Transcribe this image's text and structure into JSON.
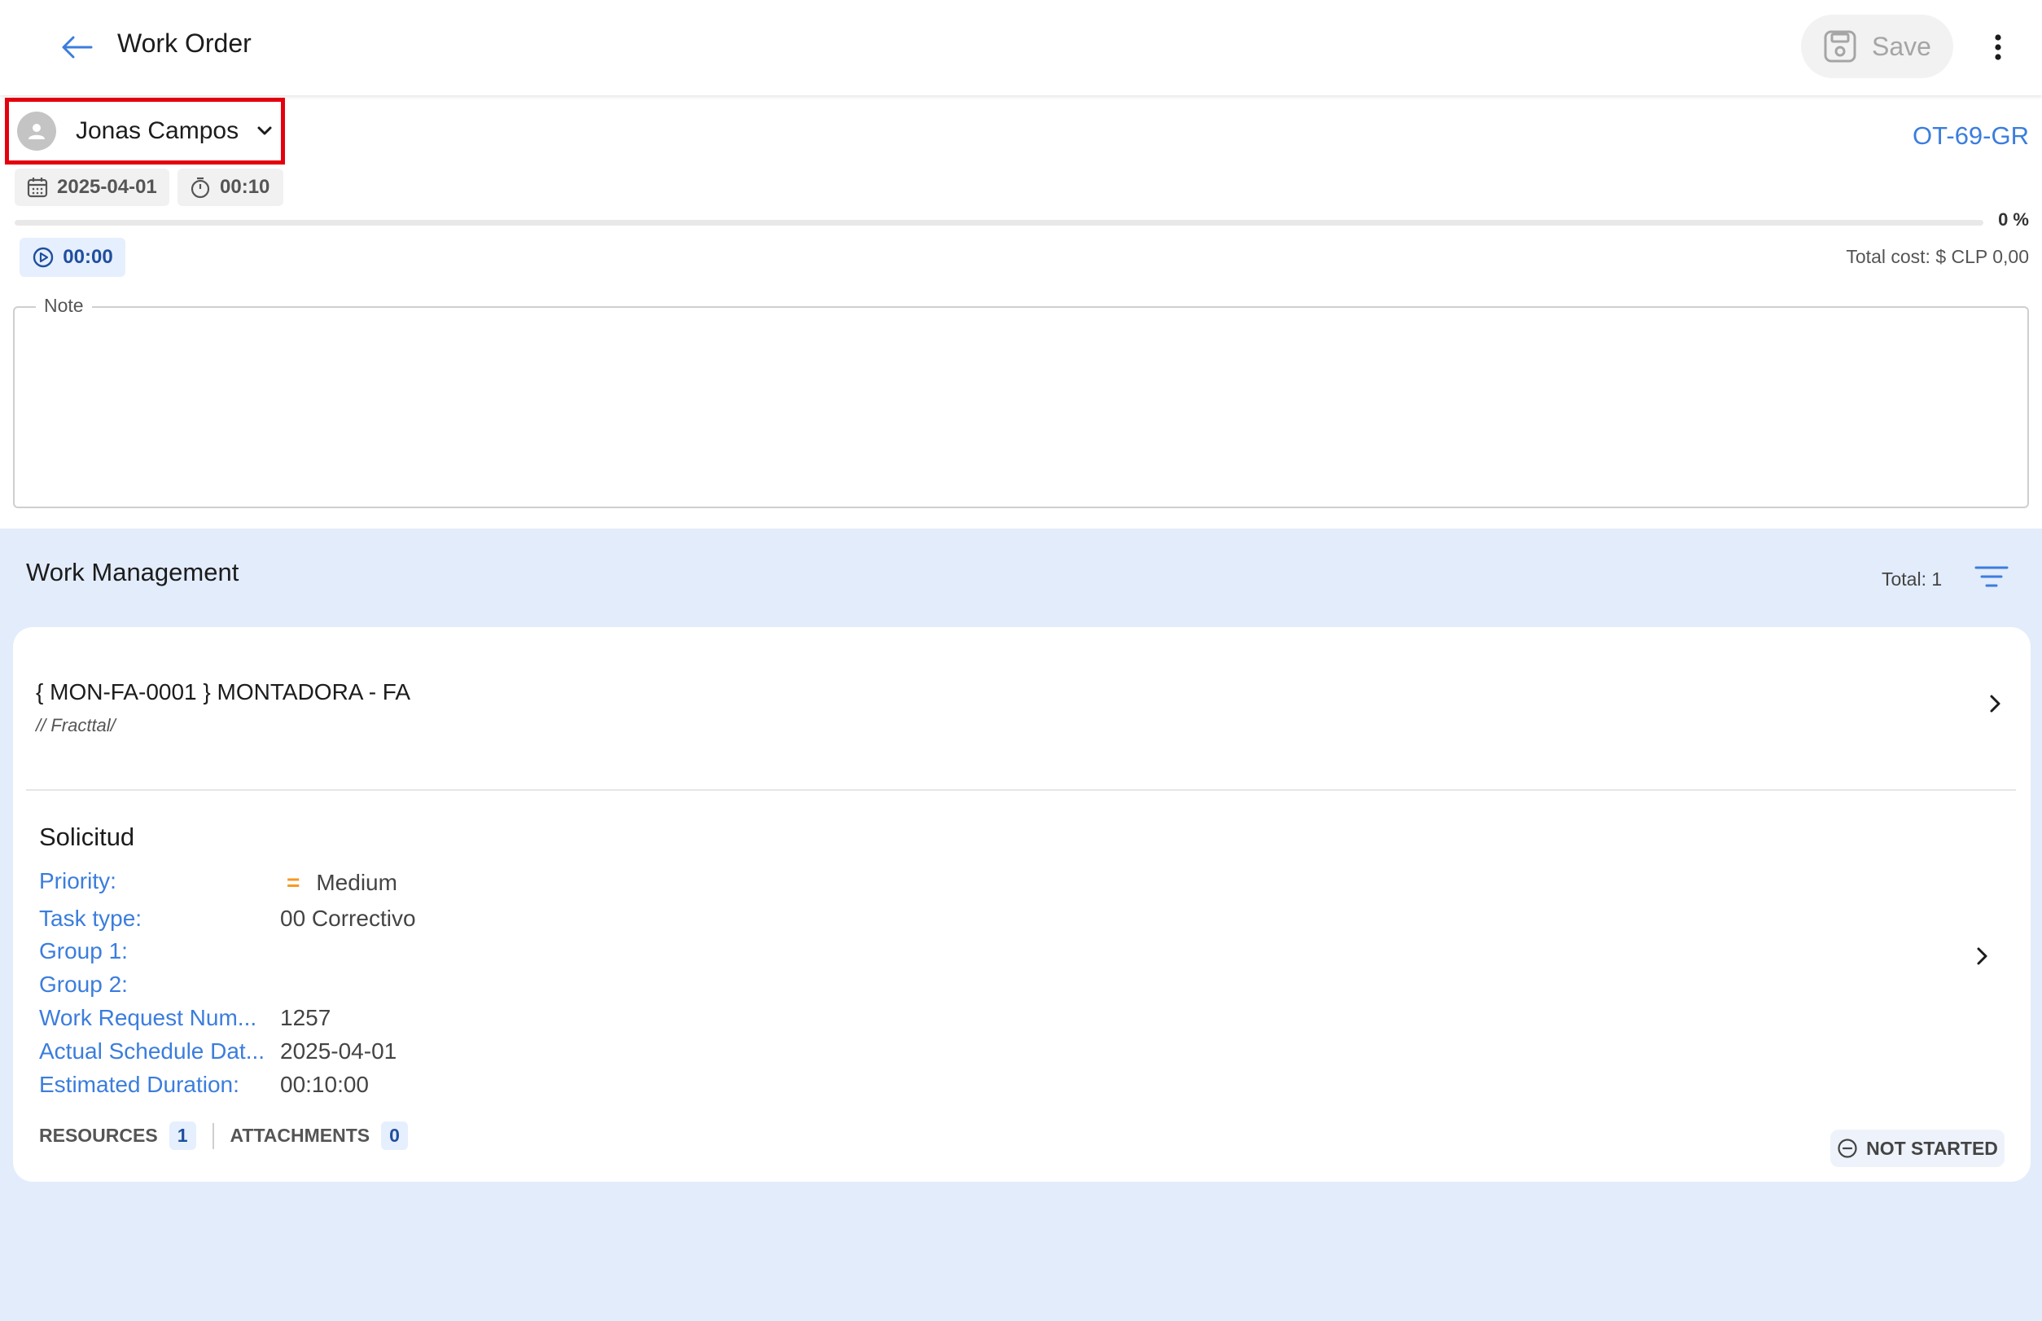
{
  "appbar": {
    "back_icon": "arrow-left-icon",
    "title": "Work Order",
    "save_label": "Save",
    "save_icon": "floppy-disk-icon",
    "more_icon": "more-vert-icon"
  },
  "header": {
    "assignee_name": "Jonas Campos",
    "assignee_icon": "person-avatar-icon",
    "wo_code": "OT-69-GR",
    "date": "2025-04-01",
    "duration": "00:10",
    "progress_percent": 0,
    "progress_label": "0 %",
    "timer": "00:00",
    "total_cost": "Total cost: $ CLP 0,00",
    "note_label": "Note",
    "note_value": ""
  },
  "work_management": {
    "title": "Work Management",
    "total": "Total: 1",
    "filter_icon": "filter-list-icon"
  },
  "card": {
    "asset_title": "{ MON-FA-0001 } MONTADORA - FA",
    "asset_path": "// Fracttal/",
    "section_title": "Solicitud",
    "fields": [
      {
        "label": "Priority:",
        "value": "Medium"
      },
      {
        "label": "Task type:",
        "value": "00 Correctivo"
      },
      {
        "label": "Group 1:",
        "value": ""
      },
      {
        "label": "Group 2:",
        "value": ""
      },
      {
        "label": "Work Request Num...",
        "value": "1257"
      },
      {
        "label": "Actual Schedule Dat...",
        "value": "2025-04-01"
      },
      {
        "label": "Estimated Duration:",
        "value": "00:10:00"
      }
    ],
    "priority_icon": "=",
    "resources_label": "RESOURCES",
    "resources_count": "1",
    "attachments_label": "ATTACHMENTS",
    "attachments_count": "0",
    "status": "NOT STARTED"
  },
  "colors": {
    "accent": "#3b7ddd",
    "background": "#e3ecfb",
    "highlight_border": "#e5000f",
    "priority_medium": "#f59a23"
  }
}
